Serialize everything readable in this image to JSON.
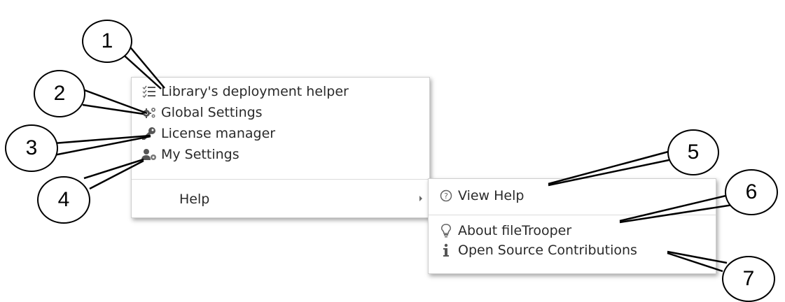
{
  "main_menu": {
    "items": [
      {
        "label": "Library's deployment helper",
        "icon": "checklist-icon"
      },
      {
        "label": "Global Settings",
        "icon": "gears-icon"
      },
      {
        "label": "License manager",
        "icon": "key-icon"
      },
      {
        "label": "My Settings",
        "icon": "user-settings-icon"
      }
    ],
    "help": {
      "label": "Help",
      "icon": "submenu-arrow-icon"
    }
  },
  "help_submenu": {
    "items": [
      {
        "label": "View Help",
        "icon": "question-circle-icon"
      },
      {
        "label": "About fileTrooper",
        "icon": "lightbulb-icon"
      },
      {
        "label": "Open Source Contributions",
        "icon": "info-icon"
      }
    ]
  },
  "callouts": [
    "1",
    "2",
    "3",
    "4",
    "5",
    "6",
    "7"
  ],
  "colors": {
    "text": "#2a2a2a",
    "icon": "#555555",
    "border": "#cfcfcf"
  }
}
